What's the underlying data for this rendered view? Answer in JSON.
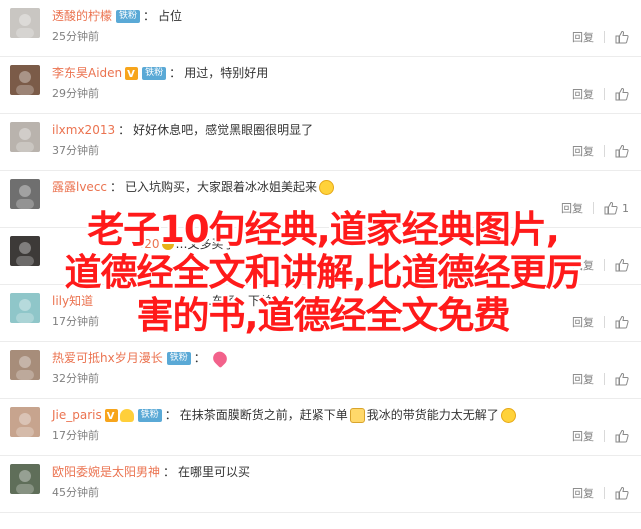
{
  "comments": [
    {
      "name": "透酸的柠檬",
      "vip": false,
      "medal": false,
      "badge": "铁粉",
      "text": "占位",
      "emoji_after": "",
      "time": "25分钟前",
      "reply": "回复",
      "likes": "",
      "avatar_color": "#c9c6c2"
    },
    {
      "name": "李东昊Aiden",
      "vip": true,
      "medal": false,
      "badge": "铁粉",
      "text": "用过，特别好用",
      "emoji_after": "",
      "time": "29分钟前",
      "reply": "回复",
      "likes": "",
      "avatar_color": "#7b5b48"
    },
    {
      "name": "ilxmx2013",
      "vip": false,
      "medal": false,
      "badge": "",
      "text": "好好休息吧，感觉黑眼圈很明显了",
      "emoji_after": "",
      "time": "37分钟前",
      "reply": "回复",
      "likes": "",
      "avatar_color": "#b9b3ad"
    },
    {
      "name": "露露lvecc",
      "vip": false,
      "medal": false,
      "badge": "",
      "text": "已入坑购买，大家跟着冰冰姐美起来",
      "emoji_after": "grin",
      "time": "",
      "reply": "回复",
      "likes": "1",
      "avatar_color": "#6f6f6f"
    },
    {
      "name": "",
      "vip": false,
      "medal": false,
      "badge": "",
      "text": "",
      "emoji_after": "",
      "time": "",
      "reply": "回复",
      "likes": "",
      "avatar_color": "#3d3a38"
    },
    {
      "name": "lily知道",
      "vip": false,
      "medal": false,
      "badge": "",
      "text": "",
      "emoji_after": "",
      "time": "17分钟前",
      "reply": "回复",
      "likes": "",
      "avatar_color": "#8fc6c9"
    },
    {
      "name": "热爱可抵hx岁月漫长",
      "vip": false,
      "medal": false,
      "badge": "铁粉",
      "text": "",
      "emoji_after": "heart",
      "time": "32分钟前",
      "reply": "回复",
      "likes": "",
      "avatar_color": "#a78d7a"
    },
    {
      "name": "Jie_paris",
      "vip": true,
      "medal": true,
      "badge": "铁粉",
      "text": "在抹茶面膜断货之前，赶紧下单",
      "emoji_after": "cat",
      "text2": "我冰的带货能力太无解了",
      "emoji_after2": "grin",
      "time": "17分钟前",
      "reply": "回复",
      "likes": "",
      "avatar_color": "#c7a48e"
    },
    {
      "name": "欧阳委婉是太阳男神",
      "vip": false,
      "medal": false,
      "badge": "",
      "text": "在哪里可以买",
      "emoji_after": "",
      "time": "45分钟前",
      "reply": "回复",
      "likes": "",
      "avatar_color": "#5f6e59"
    }
  ],
  "overlay": {
    "line1": "老子10句经典,道家经典图片,",
    "line2": "道德经全文和讲解,比道德经更厉",
    "line3": "害的书,道德经全文免费"
  },
  "partial_text": {
    "row5_fragment": "f20",
    "row5_text": "…文多买了",
    "row6_text": "…车了，下单"
  }
}
